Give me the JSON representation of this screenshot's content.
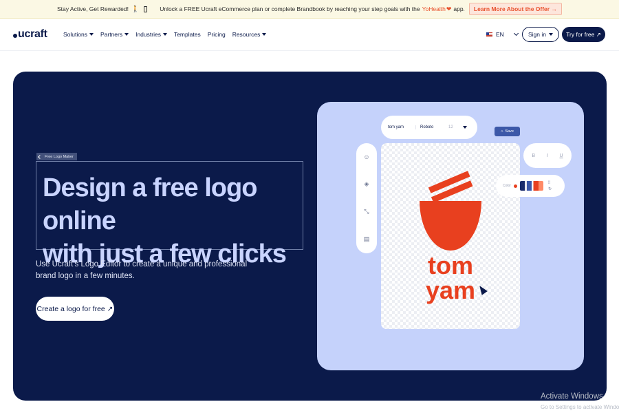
{
  "promo": {
    "text1": "Stay Active, Get Rewarded!",
    "walk_icon": "walking-person-icon",
    "phone_icon": "phone-icon",
    "text2": "Unlock a FREE Ucraft eCommerce plan or complete Brandbook by reaching your step goals with the",
    "brand": "YoHealth",
    "heart_icon": "heart-icon",
    "text3": "app.",
    "offer_label": "Learn More About the Offer →",
    "colors": {
      "background": "#fbf8e4",
      "accent": "#e8502b"
    }
  },
  "nav": {
    "logo": "ucraft",
    "menu": [
      {
        "label": "Solutions",
        "has_dropdown": true
      },
      {
        "label": "Partners",
        "has_dropdown": true
      },
      {
        "label": "Industries",
        "has_dropdown": true
      },
      {
        "label": "Templates",
        "has_dropdown": false
      },
      {
        "label": "Pricing",
        "has_dropdown": false
      },
      {
        "label": "Resources",
        "has_dropdown": true
      }
    ],
    "language": "EN",
    "signin_label": "Sign in",
    "try_label": "Try for free ↗",
    "colors": {
      "primary": "#0b1a4a"
    }
  },
  "hero": {
    "tag_label": "Free Logo Maker",
    "headline_line1": "Design a free logo online",
    "headline_line2": "with just a few clicks",
    "subtext": "Use Ucraft's Logo Editor to create a unique and professional brand logo in a few minutes.",
    "cta_label": "Create a logo for free ↗",
    "colors": {
      "background": "#0b1a4a",
      "headline": "#c9d4ff"
    }
  },
  "editor": {
    "toolbar": {
      "text_value": "tom yam",
      "font": "Roboto",
      "size_label": "12",
      "dropdown_icon": "caret-down-icon"
    },
    "save_label": "Save",
    "sidebar_icons": [
      "emoji-icon",
      "shapes-icon",
      "resize-icon",
      "layout-icon"
    ],
    "text_style": [
      "B",
      "I",
      "U"
    ],
    "color_label": "Color",
    "logo_line1": "tom",
    "logo_line2": "yam",
    "colors": {
      "panel": "#c5d2fb",
      "logo": "#e8401f"
    }
  },
  "watermark": {
    "line1": "Activate Windows",
    "line2": "Go to Settings to activate Windows."
  }
}
